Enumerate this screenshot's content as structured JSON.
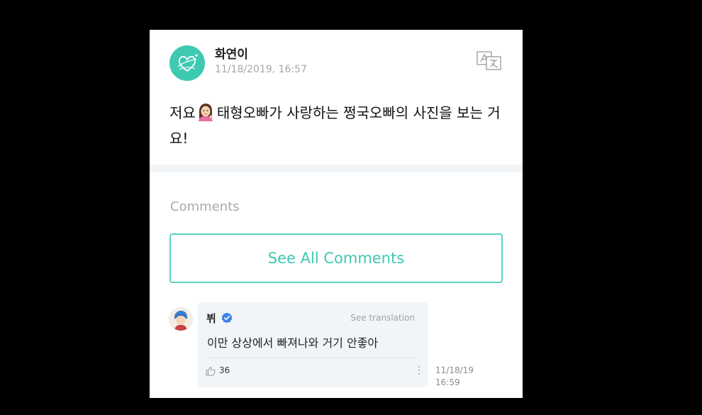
{
  "post": {
    "author": "화연이",
    "timestamp": "11/18/2019, 16:57",
    "text_before_emoji": "저요",
    "text_after_emoji": "태형오빠가 사랑하는 쩡국오빠의 사진을 보는 거요!",
    "emoji": "woman-tipping-hand-emoji"
  },
  "icons": {
    "avatar": "heart-logo-avatar",
    "translate": "translate-icon",
    "verified": "verified-badge-icon",
    "like": "thumbs-up-icon",
    "more": "more-vertical-icon"
  },
  "comments": {
    "label": "Comments",
    "see_all_label": "See All Comments",
    "items": [
      {
        "author": "뷔",
        "translate_label": "See translation",
        "text": "이만 상상에서 빠져나와 거기 안좋아",
        "likes": "36",
        "date": "11/18/19",
        "time": "16:59"
      }
    ]
  },
  "colors": {
    "accent": "#3fc7b4",
    "avatar_bg": "#3ec9b1",
    "verified": "#3b82e6"
  }
}
